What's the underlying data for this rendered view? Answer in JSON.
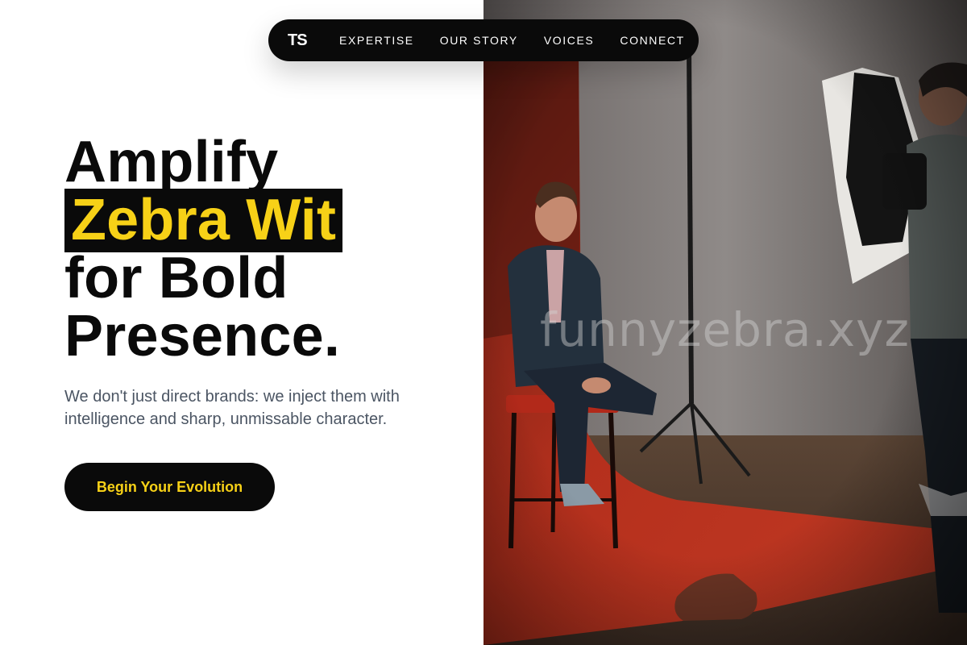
{
  "nav": {
    "logo": "TS",
    "links": [
      {
        "label": "EXPERTISE"
      },
      {
        "label": "OUR STORY"
      },
      {
        "label": "VOICES"
      },
      {
        "label": "CONNECT"
      }
    ]
  },
  "hero": {
    "headline_line1": "Amplify",
    "headline_highlight": "Zebra Wit",
    "headline_line3": "for Bold",
    "headline_line4": "Presence.",
    "subtext": "We don't just direct brands: we inject them with intelligence and sharp, unmissable character.",
    "cta_label": "Begin Your Evolution"
  },
  "photo": {
    "watermark": "funnyzebra.xyz",
    "description_icon": "studio-photo"
  },
  "colors": {
    "accent": "#f7d117",
    "ink": "#0a0a0a",
    "muted_text": "#4b5563",
    "backdrop_red": "#b8321f"
  }
}
